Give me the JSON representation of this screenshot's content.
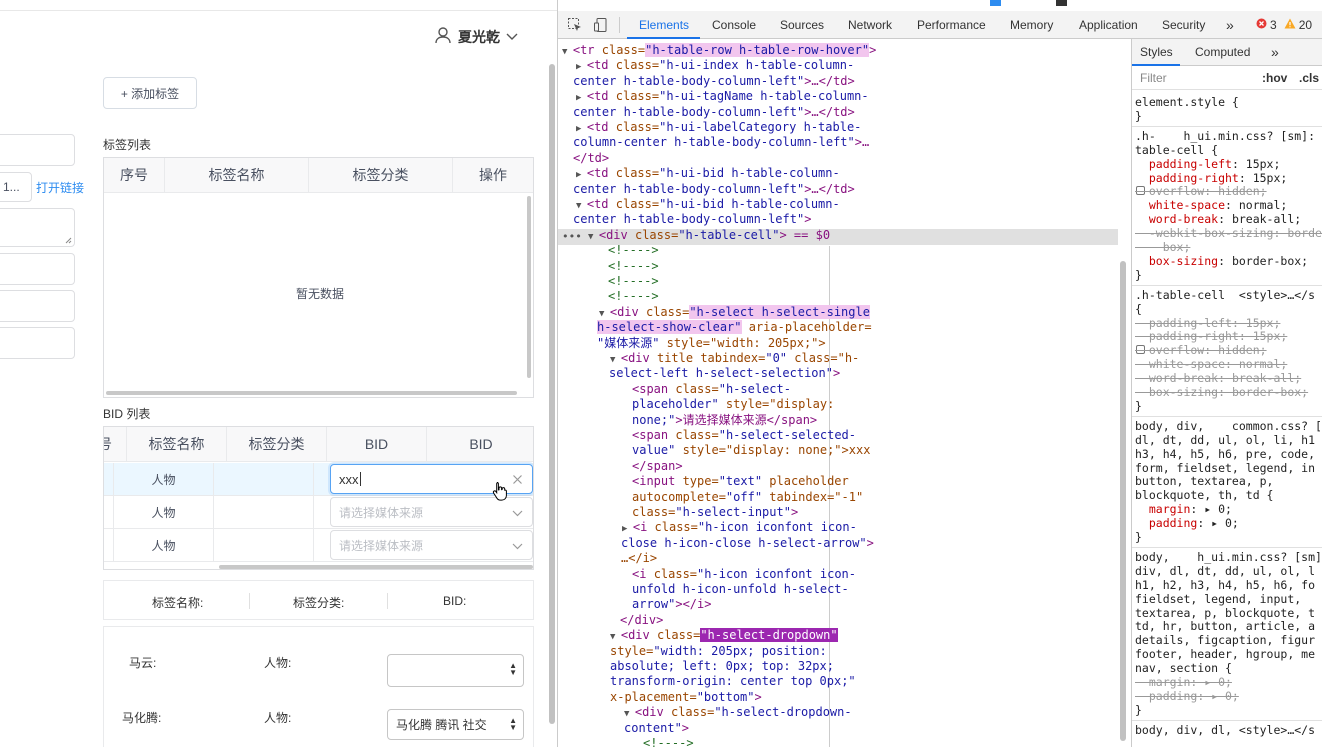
{
  "app": {
    "user_name": "夏光乾",
    "add_tag_label": "+ 添加标签",
    "tag_list_title": "标签列表",
    "tag_table_headers": [
      "序号",
      "标签名称",
      "标签分类",
      "操作"
    ],
    "empty_text": "暂无数据",
    "open_link_label": "打开链接",
    "left_input_fragment": "1...",
    "bid_list_title": "BID 列表",
    "bid_headers": [
      "号",
      "标签名称",
      "标签分类",
      "BID",
      "BID"
    ],
    "bid_rows": [
      {
        "name": "人物",
        "bid_value": "xxx",
        "placeholder": ""
      },
      {
        "name": "人物",
        "bid_value": "",
        "placeholder": "请选择媒体来源"
      },
      {
        "name": "人物",
        "bid_value": "",
        "placeholder": "请选择媒体来源"
      }
    ],
    "summary_labels": [
      "标签名称:",
      "标签分类:",
      "BID:"
    ],
    "people": [
      {
        "name": "马云:",
        "category": "人物:",
        "value": ""
      },
      {
        "name": "马化腾:",
        "category": "人物:",
        "value": "马化腾 腾讯 社交"
      }
    ]
  },
  "devtools": {
    "tabs": [
      "Elements",
      "Console",
      "Sources",
      "Network",
      "Performance",
      "Memory",
      "Application",
      "Security"
    ],
    "active_tab": "Elements",
    "more_label": "»",
    "error_count": "3",
    "warning_count": "20",
    "dom_lines": [
      [
        "▼",
        "<tr ",
        "class=",
        "\"h-table-row h-table-row-hover\"",
        ">"
      ],
      [
        "▶",
        "<td ",
        "class=",
        "\"h-ui-index h-table-column-",
        ""
      ],
      [
        "",
        "",
        "",
        "center h-table-body-column-left\"",
        ">…</td>"
      ],
      [
        "▶",
        "<td ",
        "class=",
        "\"h-ui-tagName h-table-column-",
        ""
      ],
      [
        "",
        "",
        "",
        "center h-table-body-column-left\"",
        ">…</td>"
      ],
      [
        "▶",
        "<td ",
        "class=",
        "\"h-ui-labelCategory h-table-",
        ""
      ],
      [
        "",
        "",
        "",
        "column-center h-table-body-column-left\"",
        ">…"
      ],
      [
        "",
        "",
        "",
        "",
        "</td>"
      ],
      [
        "▶",
        "<td ",
        "class=",
        "\"h-ui-bid h-table-column-",
        ""
      ],
      [
        "",
        "",
        "",
        "center h-table-body-column-left\"",
        ">…</td>"
      ],
      [
        "▼",
        "<td ",
        "class=",
        "\"h-ui-bid h-table-column-",
        ""
      ],
      [
        "",
        "",
        "",
        "center h-table-body-column-left\"",
        ">"
      ],
      [
        "▼",
        "<div ",
        "class=",
        "\"h-table-cell\"",
        "> == $0"
      ],
      [
        "",
        "",
        "",
        "",
        "<!---->"
      ],
      [
        "",
        "",
        "",
        "",
        "<!---->"
      ],
      [
        "",
        "",
        "",
        "",
        "<!---->"
      ],
      [
        "",
        "",
        "",
        "",
        "<!---->"
      ],
      [
        "▼",
        "<div ",
        "class=",
        "\"h-select h-select-single",
        ""
      ],
      [
        "",
        "",
        "",
        "h-select-show-clear\"",
        " aria-placeholder="
      ],
      [
        "",
        "",
        "",
        "\"媒体来源\"",
        " style=\"width: 205px;\">"
      ],
      [
        "▼",
        "<div ",
        "title tabindex=",
        "\"0\"",
        " class=\"h-"
      ],
      [
        "",
        "",
        "",
        "select-left h-select-selection\"",
        ">"
      ],
      [
        "",
        "<span ",
        "class=",
        "\"h-select-",
        ""
      ],
      [
        "",
        "",
        "",
        "placeholder\"",
        " style=\"display:"
      ],
      [
        "",
        "",
        "",
        "none;\"",
        ">请选择媒体来源</span>"
      ],
      [
        "",
        "<span ",
        "class=",
        "\"h-select-selected-",
        ""
      ],
      [
        "",
        "",
        "",
        "value\"",
        " style=\"display: none;\">xxx"
      ],
      [
        "",
        "",
        "",
        "",
        "</span>"
      ],
      [
        "",
        "<input ",
        "type=",
        "\"text\"",
        " placeholder"
      ],
      [
        "",
        "",
        "autocomplete=",
        "\"off\"",
        " tabindex=\"-1\""
      ],
      [
        "",
        "",
        "class=",
        "\"h-select-input\"",
        ">"
      ],
      [
        "▶",
        "<i ",
        "class=",
        "\"h-icon iconfont icon-",
        ""
      ],
      [
        "",
        "",
        "",
        "close h-icon-close h-select-arrow\"",
        ">"
      ],
      [
        "",
        "",
        "",
        "",
        "…</i>"
      ],
      [
        "",
        "<i ",
        "class=",
        "\"h-icon iconfont icon-",
        ""
      ],
      [
        "",
        "",
        "",
        "unfold h-icon-unfold h-select-",
        ""
      ],
      [
        "",
        "",
        "",
        "arrow\"",
        "></i>"
      ],
      [
        "",
        "",
        "",
        "",
        "</div>"
      ],
      [
        "▼",
        "<div ",
        "class=",
        "\"h-select-dropdown\"",
        ""
      ],
      [
        "",
        "",
        "style=",
        "\"width: 205px; position:",
        ""
      ],
      [
        "",
        "",
        "",
        "absolute; left: 0px; top: 32px;",
        ""
      ],
      [
        "",
        "",
        "",
        "transform-origin: center top 0px;\"",
        ""
      ],
      [
        "",
        "",
        "x-placement=",
        "\"bottom\"",
        ">"
      ],
      [
        "▼",
        "<div ",
        "class=",
        "\"h-select-dropdown-",
        ""
      ],
      [
        "",
        "",
        "",
        "content\"",
        ">"
      ],
      [
        "",
        "",
        "",
        "",
        "<!---->"
      ]
    ],
    "styles": {
      "tabs": [
        "Styles",
        "Computed",
        "»"
      ],
      "filter_placeholder": "Filter",
      "hov": ":hov",
      "cls": ".cls",
      "lines": [
        "element.style {",
        "}",
        ".h-    h_ui.min.css? [sm]:",
        "table-cell {",
        "  padding-left: 15px;",
        "  padding-right: 15px;",
        "  overflow: hidden;",
        "  white-space: normal;",
        "  word-break: break-all;",
        "  -webkit-box-sizing: border-",
        "    box;",
        "  box-sizing: border-box;",
        "}",
        ".h-table-cell  <style>…</s",
        "{",
        "  padding-left: 15px;",
        "  padding-right: 15px;",
        "  overflow: hidden;",
        "  white-space: normal;",
        "  word-break: break-all;",
        "  box-sizing: border-box;",
        "}",
        "body, div,    common.css? [",
        "dl, dt, dd, ul, ol, li, h1",
        "h3, h4, h5, h6, pre, code,",
        "form, fieldset, legend, in",
        "button, textarea, p,",
        "blockquote, th, td {",
        "  margin: ▸ 0;",
        "  padding: ▸ 0;",
        "}",
        "body,    h_ui.min.css? [sm]",
        "div, dl, dt, dd, ul, ol, l",
        "h1, h2, h3, h4, h5, h6, fo",
        "fieldset, legend, input,",
        "textarea, p, blockquote, t",
        "td, hr, button, article, a",
        "details, figcaption, figur",
        "footer, header, hgroup, me",
        "nav, section {",
        "  margin: ▸ 0;",
        "  padding: ▸ 0;",
        "}",
        "body, div, dl, <style>…</s"
      ]
    }
  }
}
